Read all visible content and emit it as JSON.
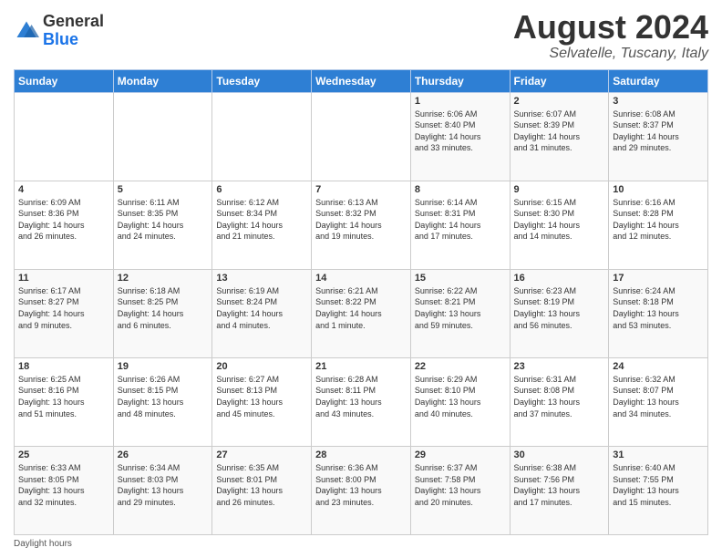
{
  "header": {
    "logo": {
      "general": "General",
      "blue": "Blue"
    },
    "title": "August 2024",
    "subtitle": "Selvatelle, Tuscany, Italy"
  },
  "calendar": {
    "days_of_week": [
      "Sunday",
      "Monday",
      "Tuesday",
      "Wednesday",
      "Thursday",
      "Friday",
      "Saturday"
    ],
    "weeks": [
      [
        {
          "day": "",
          "info": ""
        },
        {
          "day": "",
          "info": ""
        },
        {
          "day": "",
          "info": ""
        },
        {
          "day": "",
          "info": ""
        },
        {
          "day": "1",
          "info": "Sunrise: 6:06 AM\nSunset: 8:40 PM\nDaylight: 14 hours\nand 33 minutes."
        },
        {
          "day": "2",
          "info": "Sunrise: 6:07 AM\nSunset: 8:39 PM\nDaylight: 14 hours\nand 31 minutes."
        },
        {
          "day": "3",
          "info": "Sunrise: 6:08 AM\nSunset: 8:37 PM\nDaylight: 14 hours\nand 29 minutes."
        }
      ],
      [
        {
          "day": "4",
          "info": "Sunrise: 6:09 AM\nSunset: 8:36 PM\nDaylight: 14 hours\nand 26 minutes."
        },
        {
          "day": "5",
          "info": "Sunrise: 6:11 AM\nSunset: 8:35 PM\nDaylight: 14 hours\nand 24 minutes."
        },
        {
          "day": "6",
          "info": "Sunrise: 6:12 AM\nSunset: 8:34 PM\nDaylight: 14 hours\nand 21 minutes."
        },
        {
          "day": "7",
          "info": "Sunrise: 6:13 AM\nSunset: 8:32 PM\nDaylight: 14 hours\nand 19 minutes."
        },
        {
          "day": "8",
          "info": "Sunrise: 6:14 AM\nSunset: 8:31 PM\nDaylight: 14 hours\nand 17 minutes."
        },
        {
          "day": "9",
          "info": "Sunrise: 6:15 AM\nSunset: 8:30 PM\nDaylight: 14 hours\nand 14 minutes."
        },
        {
          "day": "10",
          "info": "Sunrise: 6:16 AM\nSunset: 8:28 PM\nDaylight: 14 hours\nand 12 minutes."
        }
      ],
      [
        {
          "day": "11",
          "info": "Sunrise: 6:17 AM\nSunset: 8:27 PM\nDaylight: 14 hours\nand 9 minutes."
        },
        {
          "day": "12",
          "info": "Sunrise: 6:18 AM\nSunset: 8:25 PM\nDaylight: 14 hours\nand 6 minutes."
        },
        {
          "day": "13",
          "info": "Sunrise: 6:19 AM\nSunset: 8:24 PM\nDaylight: 14 hours\nand 4 minutes."
        },
        {
          "day": "14",
          "info": "Sunrise: 6:21 AM\nSunset: 8:22 PM\nDaylight: 14 hours\nand 1 minute."
        },
        {
          "day": "15",
          "info": "Sunrise: 6:22 AM\nSunset: 8:21 PM\nDaylight: 13 hours\nand 59 minutes."
        },
        {
          "day": "16",
          "info": "Sunrise: 6:23 AM\nSunset: 8:19 PM\nDaylight: 13 hours\nand 56 minutes."
        },
        {
          "day": "17",
          "info": "Sunrise: 6:24 AM\nSunset: 8:18 PM\nDaylight: 13 hours\nand 53 minutes."
        }
      ],
      [
        {
          "day": "18",
          "info": "Sunrise: 6:25 AM\nSunset: 8:16 PM\nDaylight: 13 hours\nand 51 minutes."
        },
        {
          "day": "19",
          "info": "Sunrise: 6:26 AM\nSunset: 8:15 PM\nDaylight: 13 hours\nand 48 minutes."
        },
        {
          "day": "20",
          "info": "Sunrise: 6:27 AM\nSunset: 8:13 PM\nDaylight: 13 hours\nand 45 minutes."
        },
        {
          "day": "21",
          "info": "Sunrise: 6:28 AM\nSunset: 8:11 PM\nDaylight: 13 hours\nand 43 minutes."
        },
        {
          "day": "22",
          "info": "Sunrise: 6:29 AM\nSunset: 8:10 PM\nDaylight: 13 hours\nand 40 minutes."
        },
        {
          "day": "23",
          "info": "Sunrise: 6:31 AM\nSunset: 8:08 PM\nDaylight: 13 hours\nand 37 minutes."
        },
        {
          "day": "24",
          "info": "Sunrise: 6:32 AM\nSunset: 8:07 PM\nDaylight: 13 hours\nand 34 minutes."
        }
      ],
      [
        {
          "day": "25",
          "info": "Sunrise: 6:33 AM\nSunset: 8:05 PM\nDaylight: 13 hours\nand 32 minutes."
        },
        {
          "day": "26",
          "info": "Sunrise: 6:34 AM\nSunset: 8:03 PM\nDaylight: 13 hours\nand 29 minutes."
        },
        {
          "day": "27",
          "info": "Sunrise: 6:35 AM\nSunset: 8:01 PM\nDaylight: 13 hours\nand 26 minutes."
        },
        {
          "day": "28",
          "info": "Sunrise: 6:36 AM\nSunset: 8:00 PM\nDaylight: 13 hours\nand 23 minutes."
        },
        {
          "day": "29",
          "info": "Sunrise: 6:37 AM\nSunset: 7:58 PM\nDaylight: 13 hours\nand 20 minutes."
        },
        {
          "day": "30",
          "info": "Sunrise: 6:38 AM\nSunset: 7:56 PM\nDaylight: 13 hours\nand 17 minutes."
        },
        {
          "day": "31",
          "info": "Sunrise: 6:40 AM\nSunset: 7:55 PM\nDaylight: 13 hours\nand 15 minutes."
        }
      ]
    ]
  },
  "footer": {
    "note": "Daylight hours"
  }
}
